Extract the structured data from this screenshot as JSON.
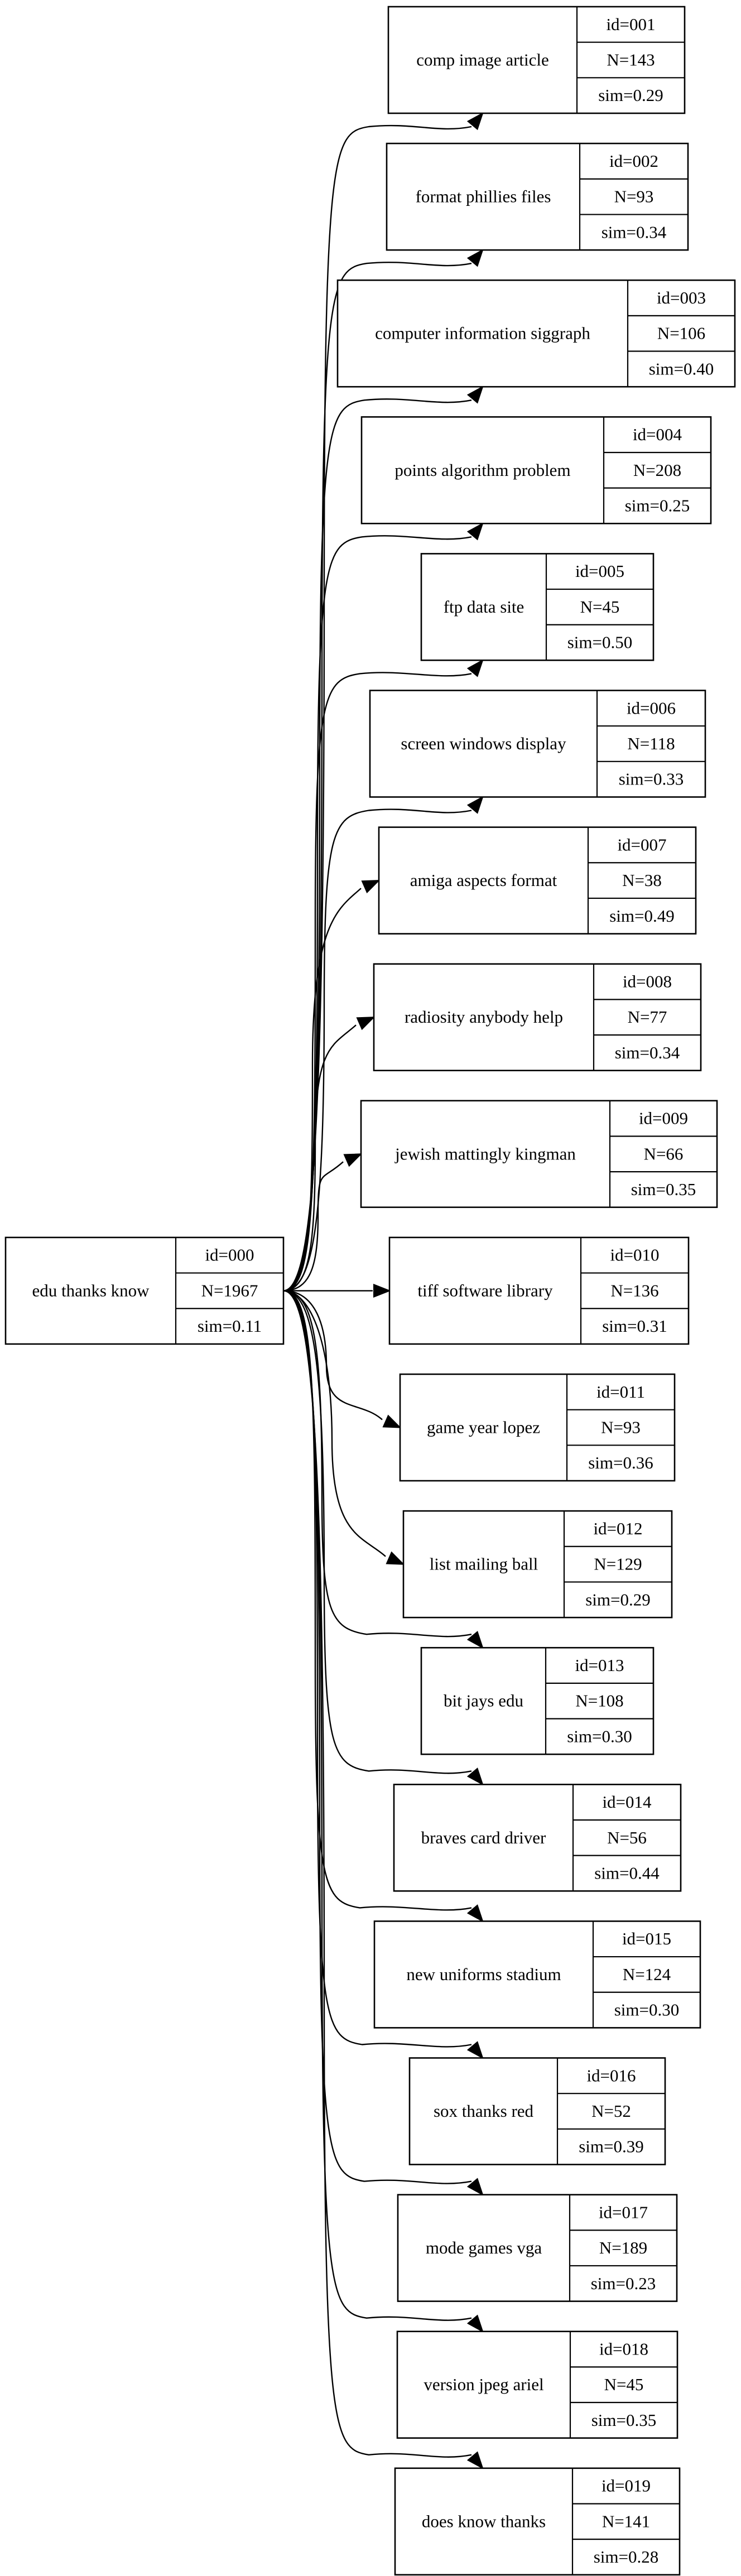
{
  "graph": {
    "type": "tree",
    "direction": "left-to-right",
    "root": {
      "id": "id=000",
      "label": "edu thanks know",
      "n": "N=1967",
      "sim": "sim=0.11"
    },
    "children": [
      {
        "id": "id=001",
        "label": "comp image article",
        "n": "N=143",
        "sim": "sim=0.29"
      },
      {
        "id": "id=002",
        "label": "format phillies files",
        "n": "N=93",
        "sim": "sim=0.34"
      },
      {
        "id": "id=003",
        "label": "computer information siggraph",
        "n": "N=106",
        "sim": "sim=0.40"
      },
      {
        "id": "id=004",
        "label": "points algorithm problem",
        "n": "N=208",
        "sim": "sim=0.25"
      },
      {
        "id": "id=005",
        "label": "ftp data site",
        "n": "N=45",
        "sim": "sim=0.50"
      },
      {
        "id": "id=006",
        "label": "screen windows display",
        "n": "N=118",
        "sim": "sim=0.33"
      },
      {
        "id": "id=007",
        "label": "amiga aspects format",
        "n": "N=38",
        "sim": "sim=0.49"
      },
      {
        "id": "id=008",
        "label": "radiosity anybody help",
        "n": "N=77",
        "sim": "sim=0.34"
      },
      {
        "id": "id=009",
        "label": "jewish mattingly kingman",
        "n": "N=66",
        "sim": "sim=0.35"
      },
      {
        "id": "id=010",
        "label": "tiff software library",
        "n": "N=136",
        "sim": "sim=0.31"
      },
      {
        "id": "id=011",
        "label": "game year lopez",
        "n": "N=93",
        "sim": "sim=0.36"
      },
      {
        "id": "id=012",
        "label": "list mailing ball",
        "n": "N=129",
        "sim": "sim=0.29"
      },
      {
        "id": "id=013",
        "label": "bit jays edu",
        "n": "N=108",
        "sim": "sim=0.30"
      },
      {
        "id": "id=014",
        "label": "braves card driver",
        "n": "N=56",
        "sim": "sim=0.44"
      },
      {
        "id": "id=015",
        "label": "new uniforms stadium",
        "n": "N=124",
        "sim": "sim=0.30"
      },
      {
        "id": "id=016",
        "label": "sox thanks red",
        "n": "N=52",
        "sim": "sim=0.39"
      },
      {
        "id": "id=017",
        "label": "mode games vga",
        "n": "N=189",
        "sim": "sim=0.23"
      },
      {
        "id": "id=018",
        "label": "version jpeg ariel",
        "n": "N=45",
        "sim": "sim=0.35"
      },
      {
        "id": "id=019",
        "label": "does know thanks",
        "n": "N=141",
        "sim": "sim=0.28"
      }
    ],
    "edges_from": "id=000"
  }
}
